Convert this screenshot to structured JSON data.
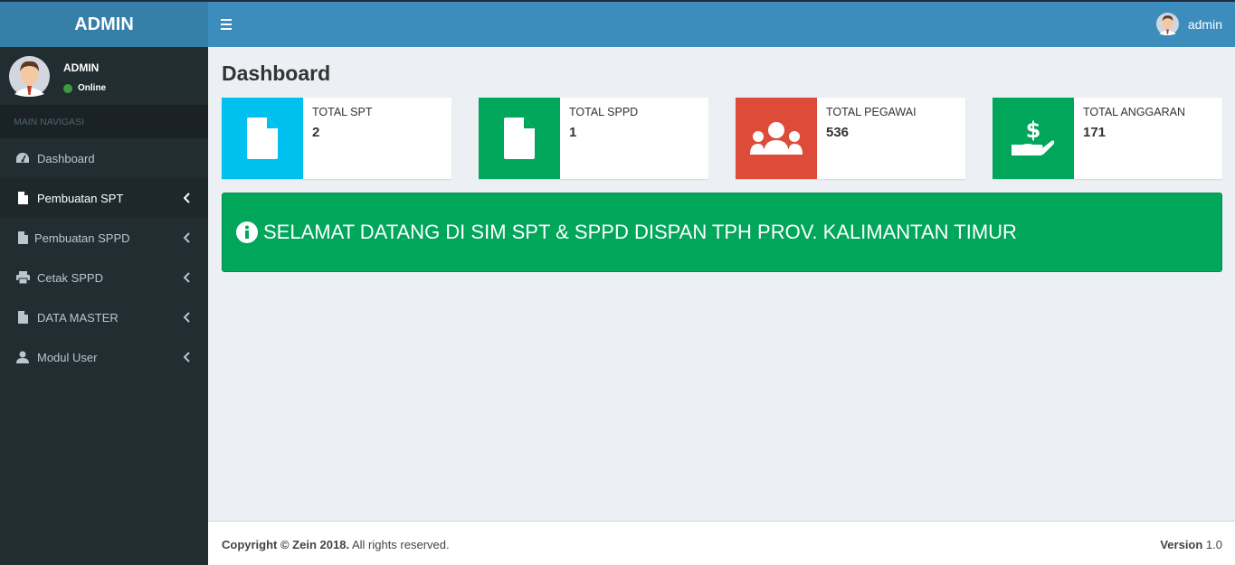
{
  "app": {
    "logo_text": "ADMIN"
  },
  "navbar": {
    "user_name": "admin",
    "toggle_icon": "hamburger-icon",
    "avatar_icon": "user-avatar-icon"
  },
  "sidebar": {
    "user": {
      "name": "ADMIN",
      "status": "Online",
      "status_color": "#3c9a41"
    },
    "header": "MAIN NAVIGASI",
    "items": [
      {
        "label": "Dashboard",
        "icon": "dashboard-gauge-icon",
        "active": false,
        "has_children": false
      },
      {
        "label": "Pembuatan SPT",
        "icon": "file-icon",
        "active": true,
        "has_children": true
      },
      {
        "label": "Pembuatan SPPD",
        "icon": "file-icon",
        "active": false,
        "has_children": true
      },
      {
        "label": "Cetak SPPD",
        "icon": "print-icon",
        "active": false,
        "has_children": true
      },
      {
        "label": "DATA MASTER",
        "icon": "file-icon",
        "active": false,
        "has_children": true
      },
      {
        "label": "Modul User",
        "icon": "user-icon",
        "active": false,
        "has_children": true
      }
    ]
  },
  "page": {
    "title": "Dashboard"
  },
  "info_boxes": [
    {
      "label": "TOTAL SPT",
      "value": "2",
      "color": "#00c0ef",
      "icon": "file-icon"
    },
    {
      "label": "TOTAL SPPD",
      "value": "1",
      "color": "#00a65a",
      "icon": "file-icon"
    },
    {
      "label": "TOTAL PEGAWAI",
      "value": "536",
      "color": "#dd4b39",
      "icon": "users-group-icon"
    },
    {
      "label": "TOTAL ANGGARAN",
      "value": "171",
      "color": "#00a65a",
      "icon": "money-hand-icon"
    }
  ],
  "callout": {
    "text": "SELAMAT DATANG DI SIM SPT & SPPD DISPAN TPH PROV. KALIMANTAN TIMUR",
    "icon": "info-circle-icon",
    "color": "#00a65a"
  },
  "footer": {
    "copyright_bold": "Copyright © Zein 2018.",
    "copyright_rest": " All rights reserved.",
    "version_label": "Version",
    "version_value": " 1.0"
  }
}
